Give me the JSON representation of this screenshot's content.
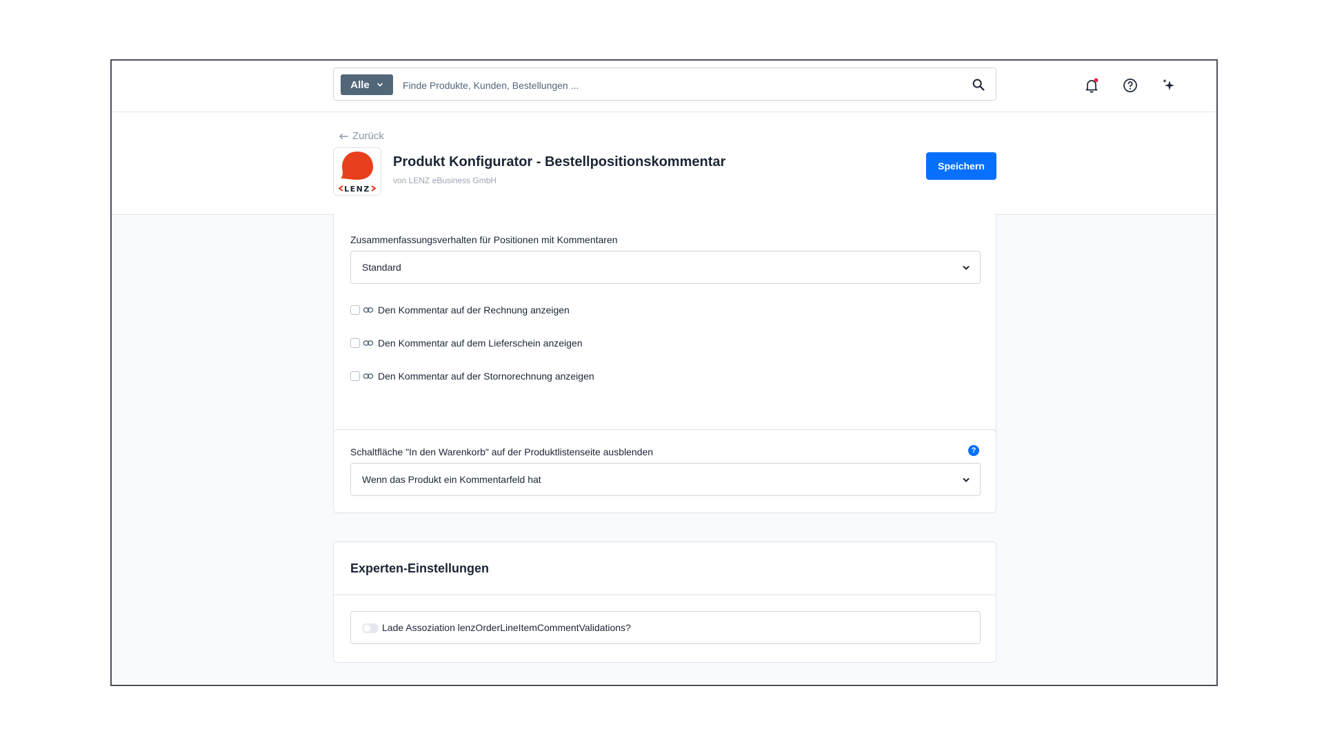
{
  "search": {
    "filter_label": "Alle",
    "placeholder": "Finde Produkte, Kunden, Bestellungen ..."
  },
  "topbar_icons": [
    "bell-icon",
    "help-circle-icon",
    "ai-sparkle-icon"
  ],
  "header": {
    "back_label": "Zurück",
    "logo_text": "LENZ",
    "title": "Produkt Konfigurator - Bestellpositionskommentar",
    "author": "von LENZ eBusiness GmbH",
    "save_label": "Speichern"
  },
  "summary_card": {
    "label": "Zusammenfassungsverhalten für Positionen mit Kommentaren",
    "value": "Standard",
    "checkboxes": [
      {
        "label": "Den Kommentar auf der Rechnung anzeigen",
        "checked": false
      },
      {
        "label": "Den Kommentar auf dem Lieferschein anzeigen",
        "checked": false
      },
      {
        "label": "Den Kommentar auf der Stornorechnung anzeigen",
        "checked": false
      }
    ]
  },
  "cart_card": {
    "label": "Schaltfläche \"In den Warenkorb\" auf der Produktlistenseite ausblenden",
    "help_symbol": "?",
    "value": "Wenn das Produkt ein Kommentarfeld hat"
  },
  "expert_card": {
    "title": "Experten-Einstellungen",
    "toggle_label": "Lade Assoziation lenzOrderLineItemCommentValidations?",
    "toggle_on": false
  },
  "colors": {
    "primary": "#0870ff",
    "filter_bg": "#52667a",
    "notification_dot": "#de294c",
    "logo_red": "#e8401c"
  }
}
